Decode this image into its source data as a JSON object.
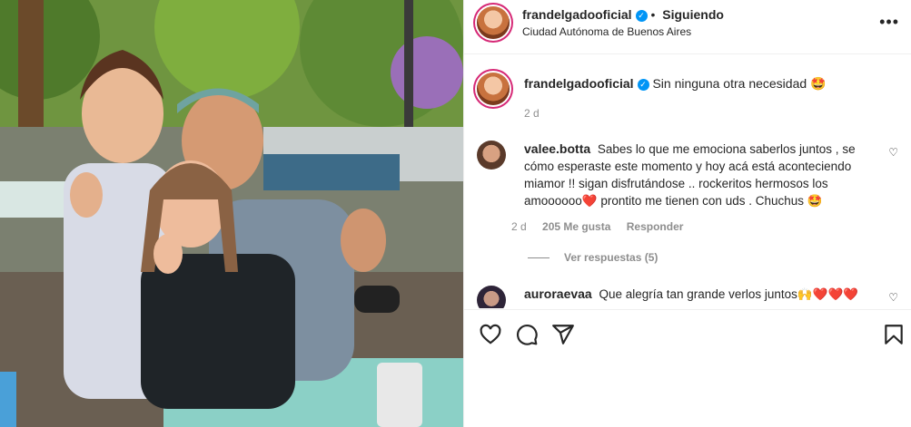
{
  "post": {
    "username": "frandelgadooficial",
    "follow_state": "Siguiendo",
    "location": "Ciudad Autónoma de Buenos Aires",
    "caption": "Sin ninguna otra necesidad 🤩",
    "caption_time": "2 d"
  },
  "comments": [
    {
      "username": "valee.botta",
      "text": "Sabes lo que me emociona saberlos juntos , se cómo esperaste este momento y hoy acá está aconteciendo miamor !! sigan disfrutándose .. rockeritos hermosos los amoooooo❤️ prontito me tienen con uds . Chuchus 🤩",
      "time": "2 d",
      "likes": "205 Me gusta",
      "reply_label": "Responder",
      "view_replies": "Ver respuestas (5)"
    },
    {
      "username": "auroraevaa",
      "text": "Que alegría tan grande verlos juntos🙌❤️❤️❤️"
    }
  ],
  "icons": {
    "more": "more-icon",
    "like": "heart-icon",
    "comment": "comment-icon",
    "share": "share-icon",
    "save": "bookmark-icon"
  },
  "colors": {
    "verified": "#0095f6",
    "heart": "#ed4956",
    "story_ring": "#d62976"
  }
}
